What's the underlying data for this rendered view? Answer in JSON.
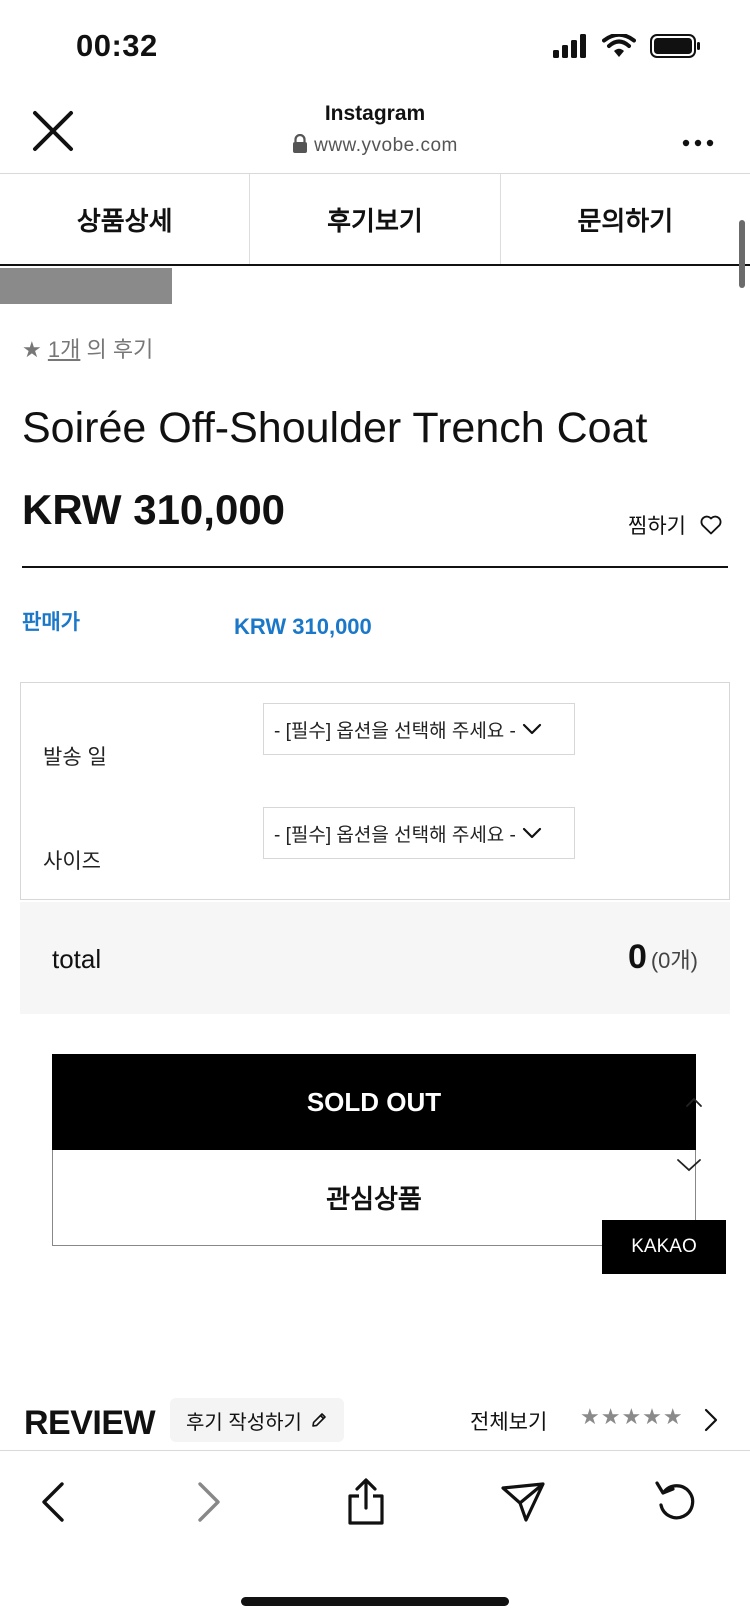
{
  "status_bar": {
    "time": "00:32"
  },
  "browser": {
    "title": "Instagram",
    "url": "www.yvobe.com"
  },
  "tabs": [
    {
      "label": "상품상세"
    },
    {
      "label": "후기보기"
    },
    {
      "label": "문의하기"
    }
  ],
  "rating": {
    "star": "★",
    "count": "1개",
    "suffix": "의 후기"
  },
  "product": {
    "name": "Soirée Off-Shoulder Trench Coat",
    "price": "KRW 310,000",
    "wish_label": "찜하기"
  },
  "sale": {
    "label": "판매가",
    "value": "KRW 310,000"
  },
  "options": [
    {
      "label": "발송 일",
      "placeholder": "- [필수] 옵션을 선택해 주세요 -"
    },
    {
      "label": "사이즈",
      "placeholder": "- [필수] 옵션을 선택해 주세요 -"
    }
  ],
  "total": {
    "label": "total",
    "value": "0",
    "count": "(0개)"
  },
  "buttons": {
    "sold_out": "SOLD OUT",
    "wishlist": "관심상품",
    "kakao": "KAKAO"
  },
  "review": {
    "title": "REVIEW",
    "write": "후기 작성하기",
    "view_all": "전체보기",
    "stars": "★★★★★"
  },
  "colors": {
    "accent_blue": "#1b78c8",
    "button_black": "#000000"
  },
  "icons": [
    "close-icon",
    "lock-icon",
    "more-icon",
    "heart-icon",
    "chevron-down-icon",
    "pencil-icon",
    "back-icon",
    "forward-icon",
    "share-icon",
    "send-icon",
    "reload-icon"
  ]
}
